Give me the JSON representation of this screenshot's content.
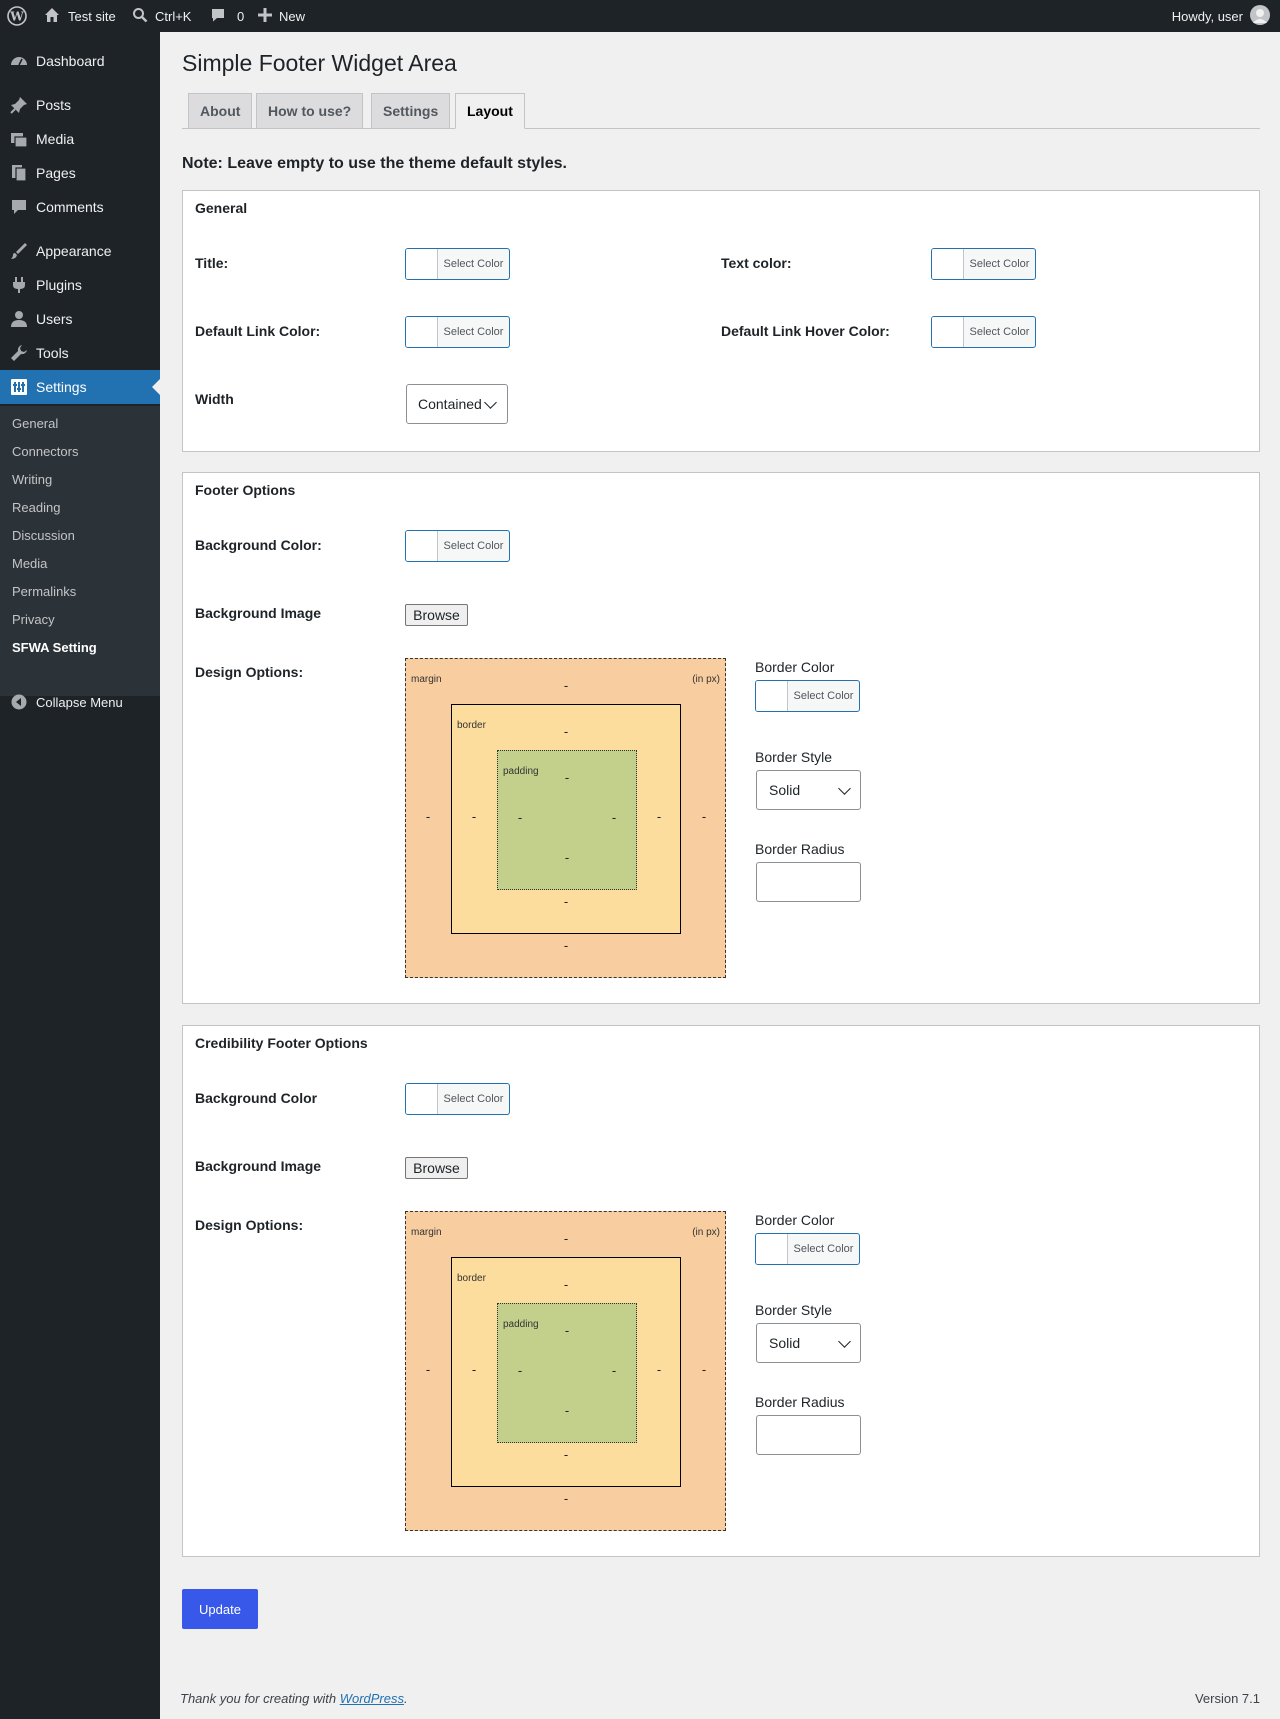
{
  "adminbar": {
    "site_name": "Test site",
    "search_shortcut": "Ctrl+K",
    "comments_count": "0",
    "new_label": "New",
    "greeting": "Howdy, user"
  },
  "sidebar": {
    "items": [
      {
        "label": "Dashboard",
        "icon": "dashboard-icon"
      },
      {
        "label": "Posts",
        "icon": "pin-icon"
      },
      {
        "label": "Media",
        "icon": "media-icon"
      },
      {
        "label": "Pages",
        "icon": "pages-icon"
      },
      {
        "label": "Comments",
        "icon": "comment-icon"
      },
      {
        "label": "Appearance",
        "icon": "brush-icon"
      },
      {
        "label": "Plugins",
        "icon": "plugin-icon"
      },
      {
        "label": "Users",
        "icon": "user-icon"
      },
      {
        "label": "Tools",
        "icon": "wrench-icon"
      },
      {
        "label": "Settings",
        "icon": "settings-icon"
      }
    ],
    "submenu": [
      "General",
      "Connectors",
      "Writing",
      "Reading",
      "Discussion",
      "Media",
      "Permalinks",
      "Privacy",
      "SFWA Setting"
    ],
    "collapse_label": "Collapse Menu"
  },
  "page": {
    "title": "Simple Footer Widget Area",
    "tabs": [
      "About",
      "How to use?",
      "Settings",
      "Layout"
    ],
    "note": "Note: Leave empty to use the theme default styles."
  },
  "color_button_label": "Select Color",
  "general": {
    "heading": "General",
    "title_label": "Title:",
    "text_color_label": "Text color:",
    "link_color_label": "Default Link Color:",
    "link_hover_label": "Default Link Hover Color:",
    "width_label": "Width",
    "width_value": "Contained"
  },
  "footer_options": {
    "heading": "Footer Options",
    "bg_color_label": "Background Color:",
    "bg_image_label": "Background Image",
    "browse_label": "Browse",
    "design_label": "Design Options:",
    "border_color_label": "Border Color",
    "border_style_label": "Border Style",
    "border_style_value": "Solid",
    "border_radius_label": "Border Radius"
  },
  "credibility_options": {
    "heading": "Credibility Footer Options",
    "bg_color_label": "Background Color",
    "bg_image_label": "Background Image",
    "browse_label": "Browse",
    "design_label": "Design Options:",
    "border_color_label": "Border Color",
    "border_style_label": "Border Style",
    "border_style_value": "Solid",
    "border_radius_label": "Border Radius"
  },
  "boxmodel": {
    "margin_label": "margin",
    "unit_label": "(in px)",
    "border_label": "border",
    "padding_label": "padding",
    "placeholder": "-"
  },
  "update_label": "Update",
  "footer": {
    "thanks_prefix": "Thank you for creating with ",
    "wordpress_link": "WordPress",
    "thanks_suffix": ".",
    "version": "Version 7.1"
  }
}
